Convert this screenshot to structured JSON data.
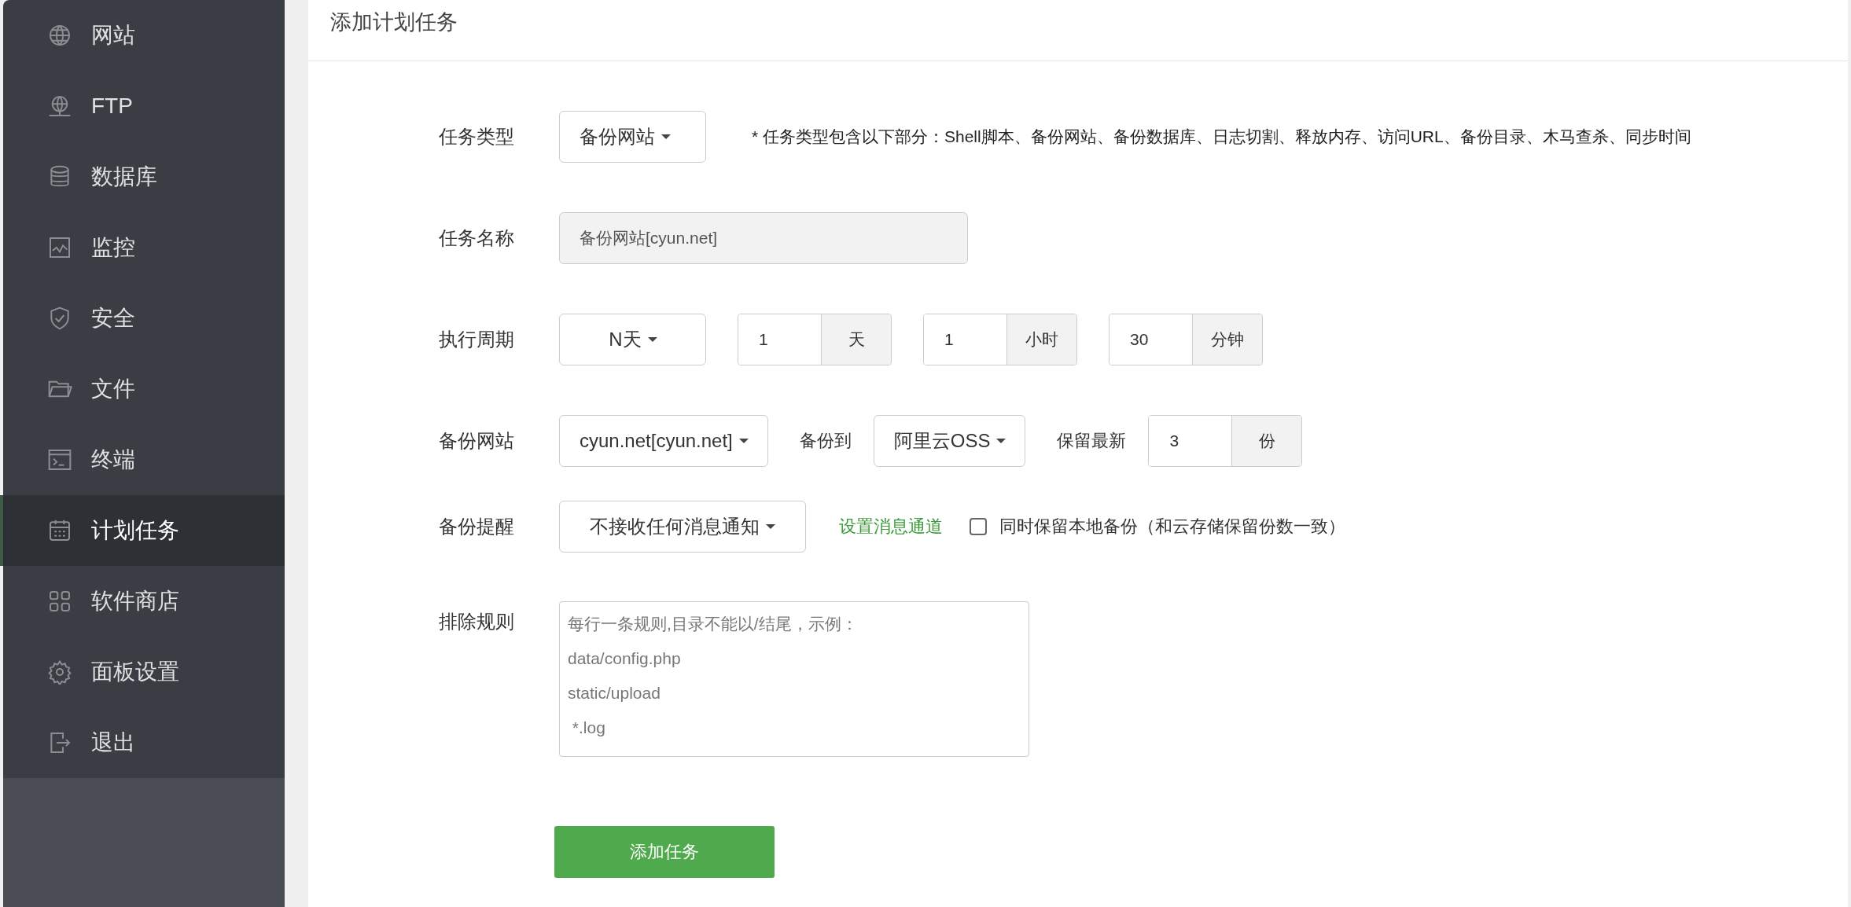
{
  "sidebar": {
    "items": [
      {
        "label": "网站",
        "kind": "globe",
        "selected": false
      },
      {
        "label": "FTP",
        "kind": "server",
        "selected": false
      },
      {
        "label": "数据库",
        "kind": "database",
        "selected": false
      },
      {
        "label": "监控",
        "kind": "monitor",
        "selected": false
      },
      {
        "label": "安全",
        "kind": "shield",
        "selected": false
      },
      {
        "label": "文件",
        "kind": "folder",
        "selected": false
      },
      {
        "label": "终端",
        "kind": "terminal",
        "selected": false
      },
      {
        "label": "计划任务",
        "kind": "calendar",
        "selected": true
      },
      {
        "label": "软件商店",
        "kind": "grid",
        "selected": false
      },
      {
        "label": "面板设置",
        "kind": "gear",
        "selected": false
      },
      {
        "label": "退出",
        "kind": "exit",
        "selected": false
      }
    ]
  },
  "panel": {
    "title": "添加计划任务"
  },
  "form": {
    "task_type": {
      "label": "任务类型",
      "value": "备份网站",
      "note": "*  任务类型包含以下部分：Shell脚本、备份网站、备份数据库、日志切割、释放内存、访问URL、备份目录、木马查杀、同步时间"
    },
    "task_name": {
      "label": "任务名称",
      "value": "备份网站[cyun.net]"
    },
    "period": {
      "label": "执行周期",
      "mode": "N天",
      "fields": [
        {
          "value": "1",
          "unit": "天"
        },
        {
          "value": "1",
          "unit": "小时"
        },
        {
          "value": "30",
          "unit": "分钟"
        }
      ]
    },
    "backup_site": {
      "label": "备份网站",
      "site": "cyun.net[cyun.net]",
      "target_label": "备份到",
      "target": "阿里云OSS",
      "keep_label": "保留最新",
      "keep": {
        "value": "3",
        "unit": "份"
      }
    },
    "notify": {
      "label": "备份提醒",
      "value": "不接收任何消息通知",
      "link": "设置消息通道",
      "keep_local": {
        "label": "同时保留本地备份（和云存储保留份数一致）",
        "checked": false
      }
    },
    "exclude": {
      "label": "排除规则",
      "placeholder": "每行一条规则,目录不能以/结尾，示例：\ndata/config.php\nstatic/upload\n *.log"
    },
    "submit": "添加任务"
  }
}
